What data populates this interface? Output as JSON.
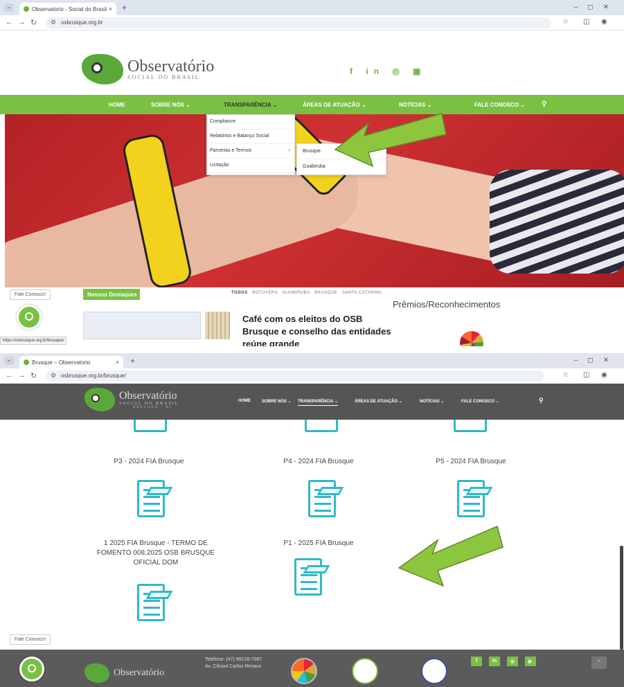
{
  "shot1": {
    "browser": {
      "tab_title": "Observatorio - Social do Brasil",
      "tab_close": "×",
      "new_tab": "+",
      "url": "osbrusque.org.br"
    },
    "logo": {
      "name": "Observatório",
      "tagline": "SOCIAL DO BRASIL"
    },
    "social_icons": [
      "facebook-icon",
      "linkedin-icon",
      "instagram-icon",
      "youtube-icon"
    ],
    "social_glyphs": "f in ◎ ▣",
    "menu": [
      {
        "label": "HOME"
      },
      {
        "label": "SOBRE NÓS ⌄"
      },
      {
        "label": "TRANSPARÊNCIA ⌄"
      },
      {
        "label": "ÁREAS DE ATUAÇÃO ⌄"
      },
      {
        "label": "NOTÍCIAS ⌄"
      },
      {
        "label": "FALE CONOSCO ⌄"
      }
    ],
    "dropdown": {
      "items": [
        "Compliance",
        "Relatórios e Balanço Social",
        "Parcerias e Termos",
        "Licitação"
      ],
      "submenu_marker": "›",
      "submenu": [
        "Brusque",
        "Guabiruba"
      ]
    },
    "fale_conosco": "Fale Conosco!",
    "destaques": {
      "label": "Nossos Destaques",
      "filters": [
        "TODOS",
        "BOTUVERÁ",
        "GUABIRUBA",
        "BRUSQUE",
        "SANTA CATARINA"
      ]
    },
    "news_title": "Café com os eleitos do OSB Brusque e conselho das entidades reúne grande",
    "premios": "Prêmios/Reconhecimentos",
    "status_url": "https://osbrusque.org.br/brusque/"
  },
  "shot2": {
    "browser": {
      "tab_title": "Brusque – Observatorio",
      "tab_close": "×",
      "new_tab": "+",
      "url": "osbrusque.org.br/brusque/"
    },
    "logo": {
      "name": "Observatório",
      "tagline": "SOCIAL DO BRASIL",
      "city": "BRUSQUE - SC"
    },
    "menu": [
      {
        "label": "HOME"
      },
      {
        "label": "SOBRE NÓS ⌄"
      },
      {
        "label": "TRANSPARÊNCIA ⌄"
      },
      {
        "label": "ÁREAS DE ATUAÇÃO ⌄"
      },
      {
        "label": "NOTÍCIAS ⌄"
      },
      {
        "label": "FALE CONOSCO ⌄"
      }
    ],
    "documents": [
      {
        "title": "P3 - 2024 FIA Brusque"
      },
      {
        "title": "P4 - 2024 FIA Brusque"
      },
      {
        "title": "P5 - 2024 FIA Brusque"
      },
      {
        "title": "1 2025 FIA Brusque - TERMO DE FOMENTO 008.2025 OSB BRUSQUE OFICIAL DOM"
      },
      {
        "title": "P1 - 2025 FIA Brusque"
      }
    ],
    "fale_conosco": "Fale Conosco!",
    "footer": {
      "phone": "Telefone: (47) 99126-7087",
      "address": "Av. Cônsul Carlos Renaux"
    }
  },
  "colors": {
    "brand_green": "#7ac143",
    "arrow_green": "#8cc63f",
    "doc_teal": "#2fb9c7",
    "dark_nav": "#555555"
  }
}
